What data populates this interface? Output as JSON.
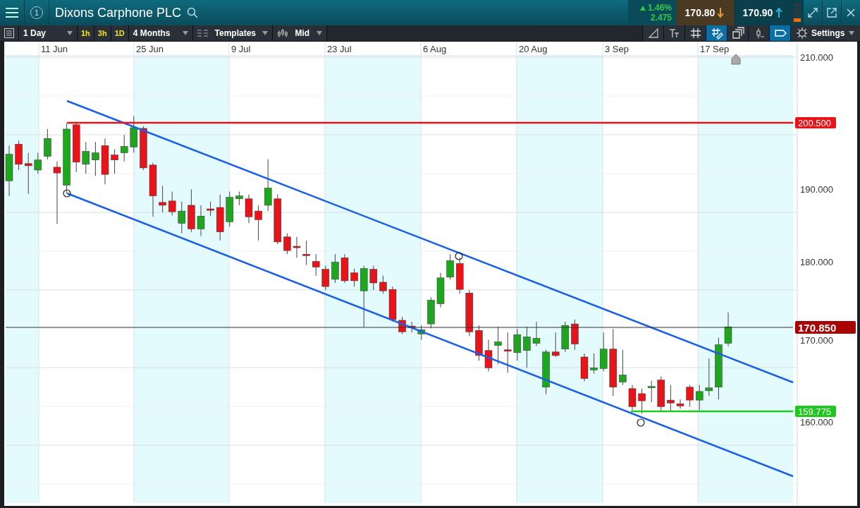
{
  "header": {
    "badge": "1",
    "title": "Dixons Carphone PLC",
    "change_percent": "1.46%",
    "change_value": "2.475",
    "sell_price": "170.80",
    "buy_price": "170.90"
  },
  "toolbar": {
    "interval": "1 Day",
    "timeframes": [
      {
        "label": "1h",
        "selected": false
      },
      {
        "label": "3h",
        "selected": false
      },
      {
        "label": "1D",
        "selected": false
      }
    ],
    "range": "4 Months",
    "templates": "Templates",
    "price_type": "Mid",
    "tools": [
      {
        "selected": false
      },
      {
        "selected": false
      },
      {
        "selected": false
      },
      {
        "selected": true
      },
      {
        "selected": false
      },
      {
        "selected": false
      },
      {
        "selected": true
      }
    ],
    "settings": "Settings"
  },
  "chart": {
    "date_labels": [
      "11 Jun",
      "25 Jun",
      "9 Jul",
      "23 Jul",
      "6 Aug",
      "20 Aug",
      "3 Sep",
      "17 Sep"
    ],
    "price_labels": [
      "210.000",
      "190.000",
      "180.000",
      "170.000",
      "160.000"
    ],
    "levels": [
      {
        "label": "200.500",
        "color": "#e8141a"
      },
      {
        "label": "159.775",
        "color": "#1fc81f"
      }
    ],
    "current_price": {
      "label": "170.850"
    }
  }
}
